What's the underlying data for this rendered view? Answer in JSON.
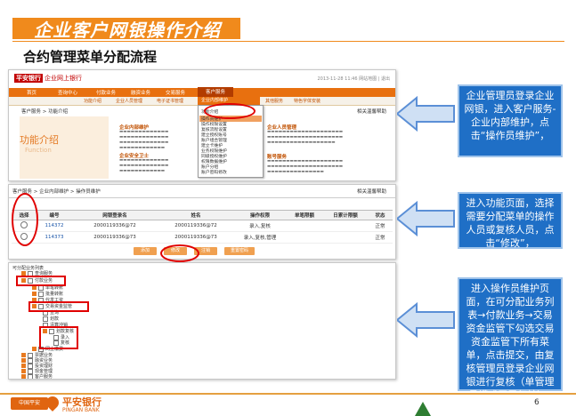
{
  "slide": {
    "title": "企业客户网银操作介绍",
    "subtitle": "合约管理菜单分配流程",
    "page_number": "6",
    "footer_brand_cn": "平安银行",
    "footer_brand_en": "PINGAN BANK",
    "footer_badge": "中国平安"
  },
  "panel1": {
    "logo_box": "平安银行",
    "logo_text": "企业网上银行",
    "top_right": "2013-11-28  11:46  网站地图 | 退出",
    "nav": [
      "首页",
      "查询中心",
      "付款业务",
      "融资业务",
      "交易服务"
    ],
    "nav_active": "客户服务",
    "sub_nav": [
      "功能介绍",
      "企业人员管理",
      "电子证书管理"
    ],
    "sub_nav_active": "企业内部维护",
    "sub_nav_more": [
      "其他服务",
      "特色字体安装"
    ],
    "breadcrumb": "客户服务 > 功能介绍",
    "help": "相关温馨帮助",
    "banner_title": "功能介绍",
    "banner_en": "Function",
    "head1": "企业内部维护",
    "head2": "企业人员管理",
    "head3": "企业人员管理",
    "head4": "账号服务",
    "sec_head": "企业安全卫士",
    "dropdown": [
      "功能介绍",
      "操作员维护",
      "操作权限设置",
      "复核流程设置",
      "建立授权账号",
      "账户组合管理",
      "建立卡维护",
      "业务权限维护",
      "同级授权维护",
      "权限数据维护",
      "账户分组",
      "账户密码修改",
      "修改企业信息"
    ]
  },
  "panel2": {
    "breadcrumb": "客户服务 > 企业内部维护 > 操作员维护",
    "help": "相关温馨帮助",
    "headers": [
      "选择",
      "编号",
      "网银登录名",
      "姓名",
      "操作权限",
      "单笔限额",
      "日累计限额",
      "状态"
    ],
    "rows": [
      [
        "",
        "114372",
        "2000119336@72",
        "2000119336@72",
        "录入,复核",
        "",
        "",
        "正常"
      ],
      [
        "",
        "114373",
        "2000119336@73",
        "2000119336@73",
        "录入,复核,管理",
        "",
        "",
        "正常"
      ]
    ],
    "buttons": [
      "添加",
      "修改",
      "注销",
      "重置密码"
    ]
  },
  "panel3": {
    "title": "可分配业务列表",
    "items": [
      {
        "label": "查询服务",
        "level": 1
      },
      {
        "label": "付款业务",
        "level": 1
      },
      {
        "label": "单笔转账",
        "level": 2
      },
      {
        "label": "批量转账",
        "level": 2
      },
      {
        "label": "代发工资",
        "level": 2
      },
      {
        "label": "交易资金监管",
        "level": 2
      },
      {
        "label": "查询",
        "level": 3
      },
      {
        "label": "划款",
        "level": 3
      },
      {
        "label": "清算冲销",
        "level": 3
      },
      {
        "label": "划款复核",
        "level": 3
      },
      {
        "label": "录入",
        "level": 4
      },
      {
        "label": "复核",
        "level": 4
      },
      {
        "label": "网上缴费",
        "level": 2
      },
      {
        "label": "票据业务",
        "level": 1
      },
      {
        "label": "融资业务",
        "level": 1
      },
      {
        "label": "投资理财",
        "level": 1
      },
      {
        "label": "现金管理",
        "level": 1
      },
      {
        "label": "客户服务",
        "level": 1
      },
      {
        "label": "其他服务",
        "level": 1
      }
    ]
  },
  "callouts": {
    "c1": "企业管理员登录企业网银，进入客户服务-企业内部维护，点击“操作员维护”，",
    "c2": "进入功能页面，选择需要分配菜单的操作人员或复核人员，点击“修改”，",
    "c3": "进入操作员维护页面，在可分配业务列表→付款业务→交易资金监管下勾选交易资金监管下所有菜单，点击提交，由复核管理员登录企业网银进行复核（单管理员模式无需复核）。"
  },
  "colors": {
    "orange": "#f08a1c",
    "callout_blue": "#1f6fc6",
    "arrow_blue": "#5b8fd6",
    "highlight_red": "#e00000"
  }
}
